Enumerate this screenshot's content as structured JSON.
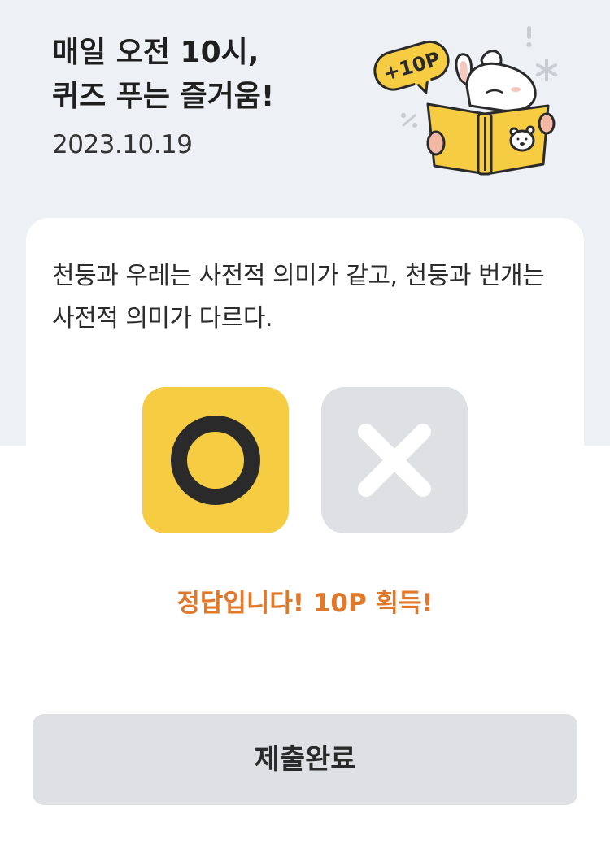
{
  "header": {
    "title_line1": "매일 오전 10시,",
    "title_line2": "퀴즈 푸는 즐거움!",
    "date": "2023.10.19"
  },
  "illustration": {
    "badge_text": "+10P",
    "icon": "rabbit-reading-book"
  },
  "quiz": {
    "question": "천둥과 우레는 사전적 의미가 같고, 천둥과 번개는 사전적 의미가 다르다.",
    "answers": [
      {
        "id": "o",
        "icon": "circle-o-icon",
        "selected": true
      },
      {
        "id": "x",
        "icon": "cross-x-icon",
        "selected": false
      }
    ],
    "result_text": "정답입니다! 10P 획득!"
  },
  "submit_label": "제출완료",
  "colors": {
    "background_top": "#edf0f5",
    "selected_yellow": "#f5cc42",
    "unselected_gray": "#dee0e3",
    "result_orange": "#e2782a",
    "button_gray": "#dee0e3"
  }
}
